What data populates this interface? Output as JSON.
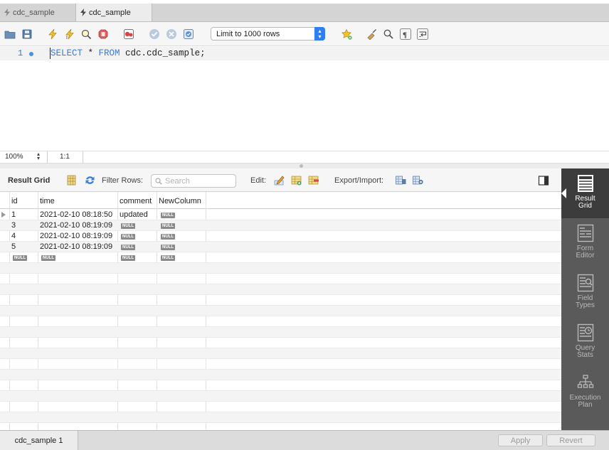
{
  "tabs": [
    {
      "label": "cdc_sample",
      "active": false
    },
    {
      "label": "cdc_sample",
      "active": true
    }
  ],
  "toolbar": {
    "limit_select": "Limit to 1000 rows"
  },
  "editor": {
    "line_number": "1",
    "code_kw1": "SELECT",
    "code_mid": " * ",
    "code_kw2": "FROM",
    "code_rest": " cdc.cdc_sample;"
  },
  "editor_status": {
    "zoom": "100%",
    "position": "1:1"
  },
  "result_toolbar": {
    "title": "Result Grid",
    "filter_label": "Filter Rows:",
    "search_placeholder": "Search",
    "edit_label": "Edit:",
    "export_label": "Export/Import:"
  },
  "grid": {
    "columns": [
      "id",
      "time",
      "comment",
      "NewColumn"
    ],
    "null_label": "NULL",
    "rows": [
      {
        "id": "1",
        "time": "2021-02-10 08:18:50",
        "comment": "updated",
        "newcolumn": null
      },
      {
        "id": "3",
        "time": "2021-02-10 08:19:09",
        "comment": null,
        "newcolumn": null
      },
      {
        "id": "4",
        "time": "2021-02-10 08:19:09",
        "comment": null,
        "newcolumn": null
      },
      {
        "id": "5",
        "time": "2021-02-10 08:19:09",
        "comment": null,
        "newcolumn": null
      },
      {
        "id": null,
        "time": null,
        "comment": null,
        "newcolumn": null
      }
    ]
  },
  "side_panel": {
    "items": [
      {
        "line1": "Result",
        "line2": "Grid",
        "active": true
      },
      {
        "line1": "Form",
        "line2": "Editor",
        "active": false
      },
      {
        "line1": "Field",
        "line2": "Types",
        "active": false
      },
      {
        "line1": "Query",
        "line2": "Stats",
        "active": false
      },
      {
        "line1": "Execution",
        "line2": "Plan",
        "active": false
      }
    ]
  },
  "bottom": {
    "result_tab": "cdc_sample 1",
    "apply": "Apply",
    "revert": "Revert"
  },
  "colors": {
    "accent": "#2f7ef5",
    "keyword": "#3a7bd5",
    "side_panel": "#5a5a5a"
  }
}
